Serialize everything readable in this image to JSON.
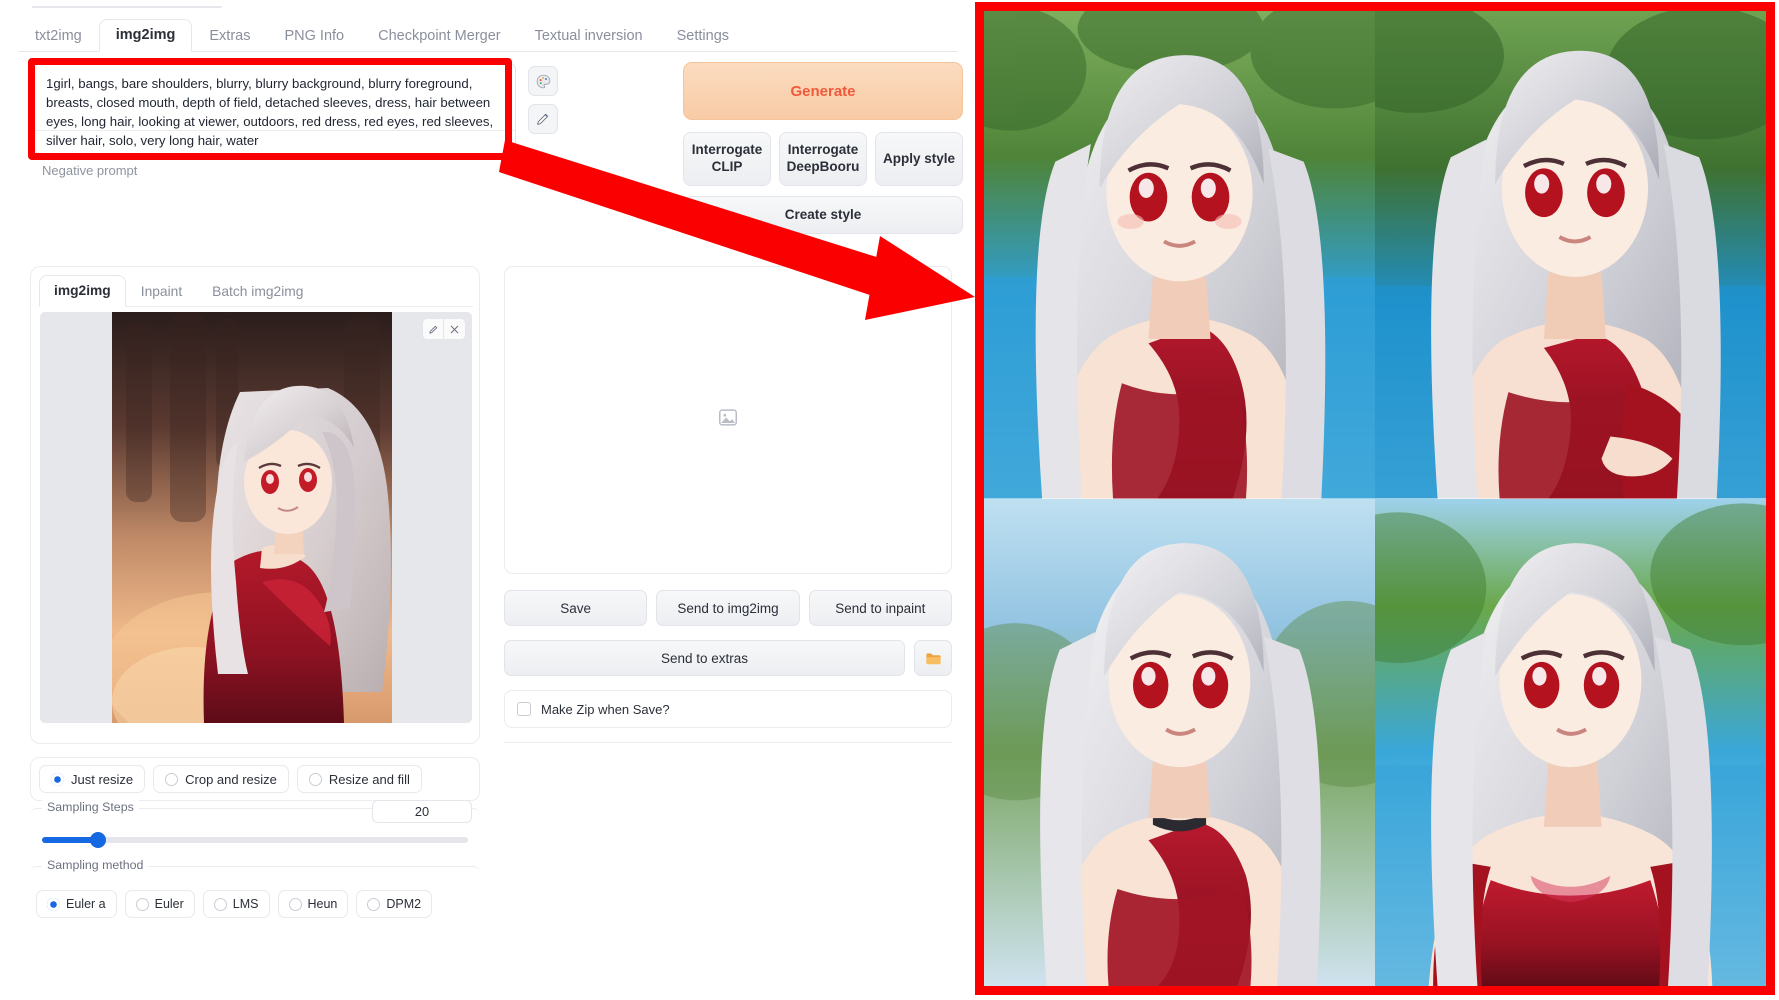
{
  "app": {
    "main_tabs": [
      {
        "label": "txt2img",
        "active": false
      },
      {
        "label": "img2img",
        "active": true
      },
      {
        "label": "Extras",
        "active": false
      },
      {
        "label": "PNG Info",
        "active": false
      },
      {
        "label": "Checkpoint Merger",
        "active": false
      },
      {
        "label": "Textual inversion",
        "active": false
      },
      {
        "label": "Settings",
        "active": false
      }
    ]
  },
  "prompt": {
    "value": "1girl, bangs, bare shoulders, blurry, blurry background, blurry foreground, breasts, closed mouth, depth of field, detached sleeves, dress, hair between eyes, long hair, looking at viewer, outdoors, red dress, red eyes, red sleeves, silver hair, solo, very long hair, water",
    "negative_placeholder": "Negative prompt"
  },
  "prompt_tools": [
    {
      "name": "paste-style-icon",
      "glyph": "🎨"
    },
    {
      "name": "clear-prompt-icon",
      "glyph": "✒"
    }
  ],
  "actions": {
    "generate_label": "Generate",
    "interrogate_clip_label": "Interrogate CLIP",
    "interrogate_deepbooru_label": "Interrogate DeepBooru",
    "apply_style_label": "Apply style",
    "create_style_label": "Create style"
  },
  "source_panel": {
    "sub_tabs": [
      {
        "label": "img2img",
        "active": true
      },
      {
        "label": "Inpaint",
        "active": false
      },
      {
        "label": "Batch img2img",
        "active": false
      }
    ],
    "tools": [
      {
        "name": "edit-icon",
        "glyph": "✎"
      },
      {
        "name": "close-icon",
        "glyph": "✕"
      }
    ]
  },
  "resize_modes": [
    {
      "label": "Just resize",
      "selected": true
    },
    {
      "label": "Crop and resize",
      "selected": false
    },
    {
      "label": "Resize and fill",
      "selected": false
    }
  ],
  "sampling": {
    "steps_label": "Sampling Steps",
    "steps_value": "20",
    "method_label": "Sampling method",
    "methods": [
      {
        "label": "Euler a",
        "selected": true
      },
      {
        "label": "Euler",
        "selected": false
      },
      {
        "label": "LMS",
        "selected": false
      },
      {
        "label": "Heun",
        "selected": false
      },
      {
        "label": "DPM2",
        "selected": false
      }
    ]
  },
  "results": {
    "placeholder_icon": "image-placeholder-icon",
    "save_label": "Save",
    "send_img2img_label": "Send to img2img",
    "send_inpaint_label": "Send to inpaint",
    "send_extras_label": "Send to extras",
    "folder_icon": "folder-icon",
    "make_zip_label": "Make Zip when Save?"
  },
  "gallery": {
    "count": 4,
    "items": [
      {
        "name": "generated-image-1",
        "scene": "riverside",
        "sky": "#9fd4ea",
        "foliage": "#4f7f3a",
        "water": "#2a9ed8"
      },
      {
        "name": "generated-image-2",
        "scene": "riverside",
        "sky": "#a7d8ee",
        "foliage": "#4a7a36",
        "water": "#1f93cf"
      },
      {
        "name": "generated-image-3",
        "scene": "riverside",
        "sky": "#b9dff0",
        "foliage": "#6f9a55",
        "water": "#4bb2e0"
      },
      {
        "name": "generated-image-4",
        "scene": "riverside",
        "sky": "#a9d9ef",
        "foliage": "#5c8c44",
        "water": "#35a3d8"
      }
    ]
  },
  "annotation": {
    "highlight_color": "#fb0000",
    "arrow_color": "#fb0000",
    "from": "prompt-textarea",
    "to": "generated-image-gallery"
  }
}
